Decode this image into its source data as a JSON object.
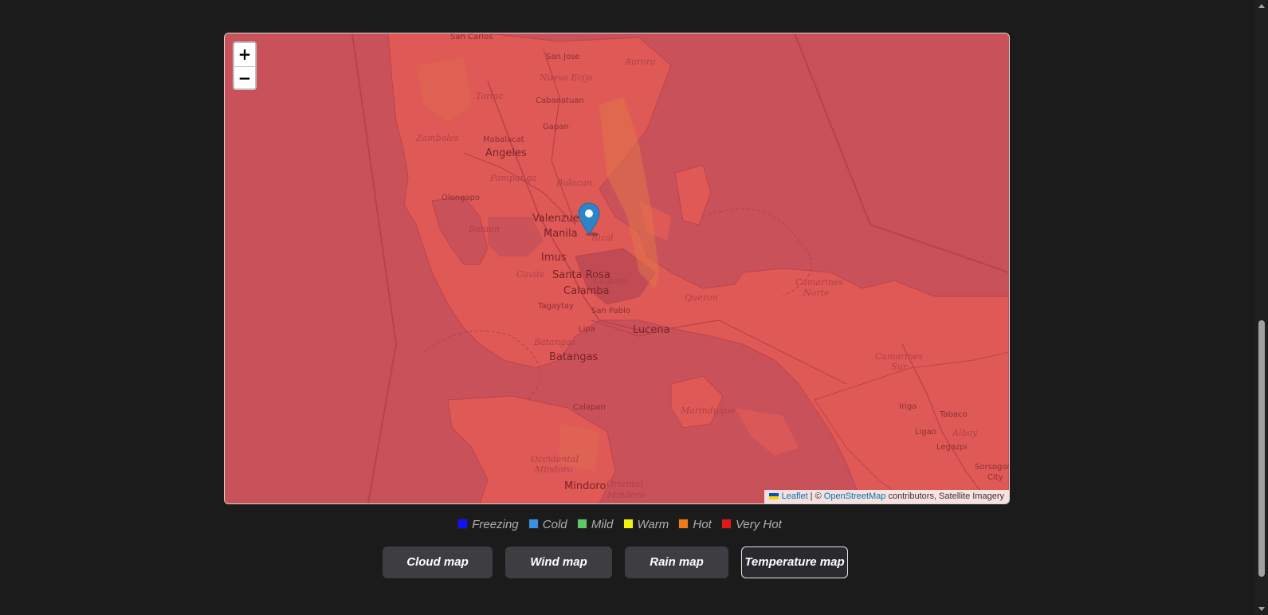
{
  "map": {
    "zoom_in": "+",
    "zoom_out": "−",
    "labels": {
      "san_carlos": "San Carlos",
      "san_jose": "San Jose",
      "aurora": "Aurora",
      "nueva_ecija": "Nueva Ecija",
      "tarlac": "Tarlac",
      "cabanatuan": "Cabanatuan",
      "zambales": "Zambales",
      "mabalacat": "Mabalacat",
      "gapan": "Gapan",
      "angeles": "Angeles",
      "pampanga": "Pampanga",
      "bulacan": "Bulacan",
      "olongapo": "Olongapo",
      "valenzuela": "Valenzuela",
      "manila": "Manila",
      "rizal": "Rizal",
      "bataan": "Bataan",
      "imus": "Imus",
      "cavite": "Cavite",
      "santa_rosa": "Santa Rosa",
      "laguna": "Laguna",
      "calamba": "Calamba",
      "tagaytay": "Tagaytay",
      "san_pablo": "San Pablo",
      "quezon": "Quezon",
      "lipa": "Lipa",
      "lucena": "Lucena",
      "batangas_prov": "Batangas",
      "batangas": "Batangas",
      "camarines_norte_1": "Camarines",
      "camarines_norte_2": "Norte",
      "camarines_sur_1": "Camarines",
      "camarines_sur_2": "Sur",
      "marinduque": "Marinduque",
      "calapan": "Calapan",
      "iriga": "Iriga",
      "tabaco": "Tabaco",
      "ligao": "Ligao",
      "albay": "Albay",
      "legazpi": "Legazpi",
      "occidental_mindoro_1": "Occidental",
      "occidental_mindoro_2": "Mindoro",
      "mindoro": "Mindoro",
      "oriental_mindoro_1": "Oriental",
      "oriental_mindoro_2": "Mindoro",
      "sorsogon_1": "Sorsogon",
      "sorsogon_2": "City"
    },
    "attribution": {
      "leaflet": "Leaflet",
      "sep": " | © ",
      "osm": "OpenStreetMap",
      "rest": " contributors, Satellite Imagery"
    }
  },
  "legend": [
    {
      "label": "Freezing",
      "color": "#1010ff"
    },
    {
      "label": "Cold",
      "color": "#3a8fe0"
    },
    {
      "label": "Mild",
      "color": "#5fc66a"
    },
    {
      "label": "Warm",
      "color": "#f2f20a"
    },
    {
      "label": "Hot",
      "color": "#f07a1a"
    },
    {
      "label": "Very Hot",
      "color": "#e01818"
    }
  ],
  "buttons": {
    "cloud": "Cloud map",
    "wind": "Wind map",
    "rain": "Rain map",
    "temperature": "Temperature map"
  },
  "active_map": "Temperature map",
  "colors": {
    "overlay": "#c9515a",
    "land": "#e05a55",
    "marker": "#2f84c8"
  }
}
